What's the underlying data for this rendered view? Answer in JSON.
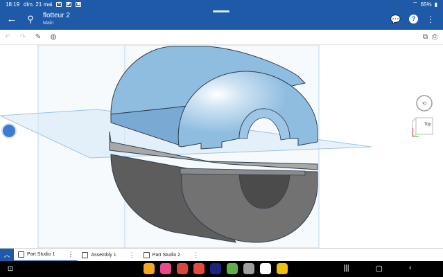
{
  "status_bar": {
    "time": "18:19",
    "date": "dim. 21 mai",
    "battery": "65%"
  },
  "header": {
    "title": "flotteur 2",
    "subtitle": "Main",
    "back_icon": "arrow-left-icon",
    "doc_icon": "document-tree-icon",
    "chat_icon": "chat-icon",
    "help_label": "?",
    "more_icon": "more-vertical-icon"
  },
  "toolbar": {
    "undo_icon": "undo-icon",
    "redo_icon": "redo-icon",
    "sketch_icon": "pencil-icon",
    "view_icon": "sphere-icon",
    "right_icons": [
      "layers-icon",
      "print-icon"
    ]
  },
  "viewport": {
    "view_cube_face": "Top",
    "part_color_upper": "#8fbde0",
    "part_color_lower": "#6c6c6c",
    "plane_color": "#d6e8f6"
  },
  "tabs": [
    {
      "label": "Part Studio 1",
      "active": true
    },
    {
      "label": "Assembly 1",
      "active": false
    },
    {
      "label": "Part Studio 2",
      "active": false
    }
  ],
  "nav": {
    "dock_colors": [
      "#f5a623",
      "#e84a8a",
      "#d9463c",
      "#e54b3a",
      "#1a237e",
      "#5fb04a",
      "#9e9e9e",
      "#ffffff",
      "#f0c010"
    ]
  }
}
